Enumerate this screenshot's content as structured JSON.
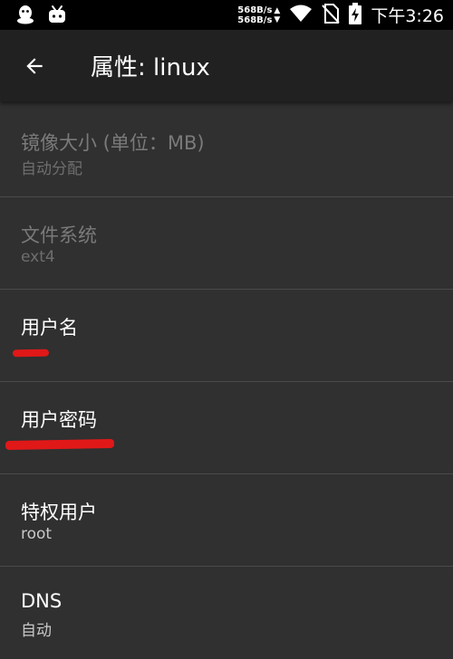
{
  "status_bar": {
    "net_up": "568B/s",
    "net_down": "568B/s",
    "time": "下午3:26",
    "icons": [
      "qq-icon",
      "bilibili-icon",
      "wifi-icon",
      "no-sim-icon",
      "battery-charging-icon"
    ]
  },
  "app_bar": {
    "title": "属性: linux",
    "back_icon": "arrow-left-icon"
  },
  "prefs": [
    {
      "title": "镜像大小 (单位：MB)",
      "summary": "自动分配",
      "enabled": false
    },
    {
      "title": "文件系统",
      "summary": "ext4",
      "enabled": false
    },
    {
      "title": "用户名",
      "summary": "",
      "enabled": true,
      "redacted": true
    },
    {
      "title": "用户密码",
      "summary": "",
      "enabled": true,
      "redacted": true
    },
    {
      "title": "特权用户",
      "summary": "root",
      "enabled": true
    },
    {
      "title": "DNS",
      "summary": "自动",
      "enabled": true
    }
  ],
  "colors": {
    "background": "#303030",
    "app_bar": "#212121",
    "status_bar": "#000000",
    "redaction": "#e01818"
  }
}
